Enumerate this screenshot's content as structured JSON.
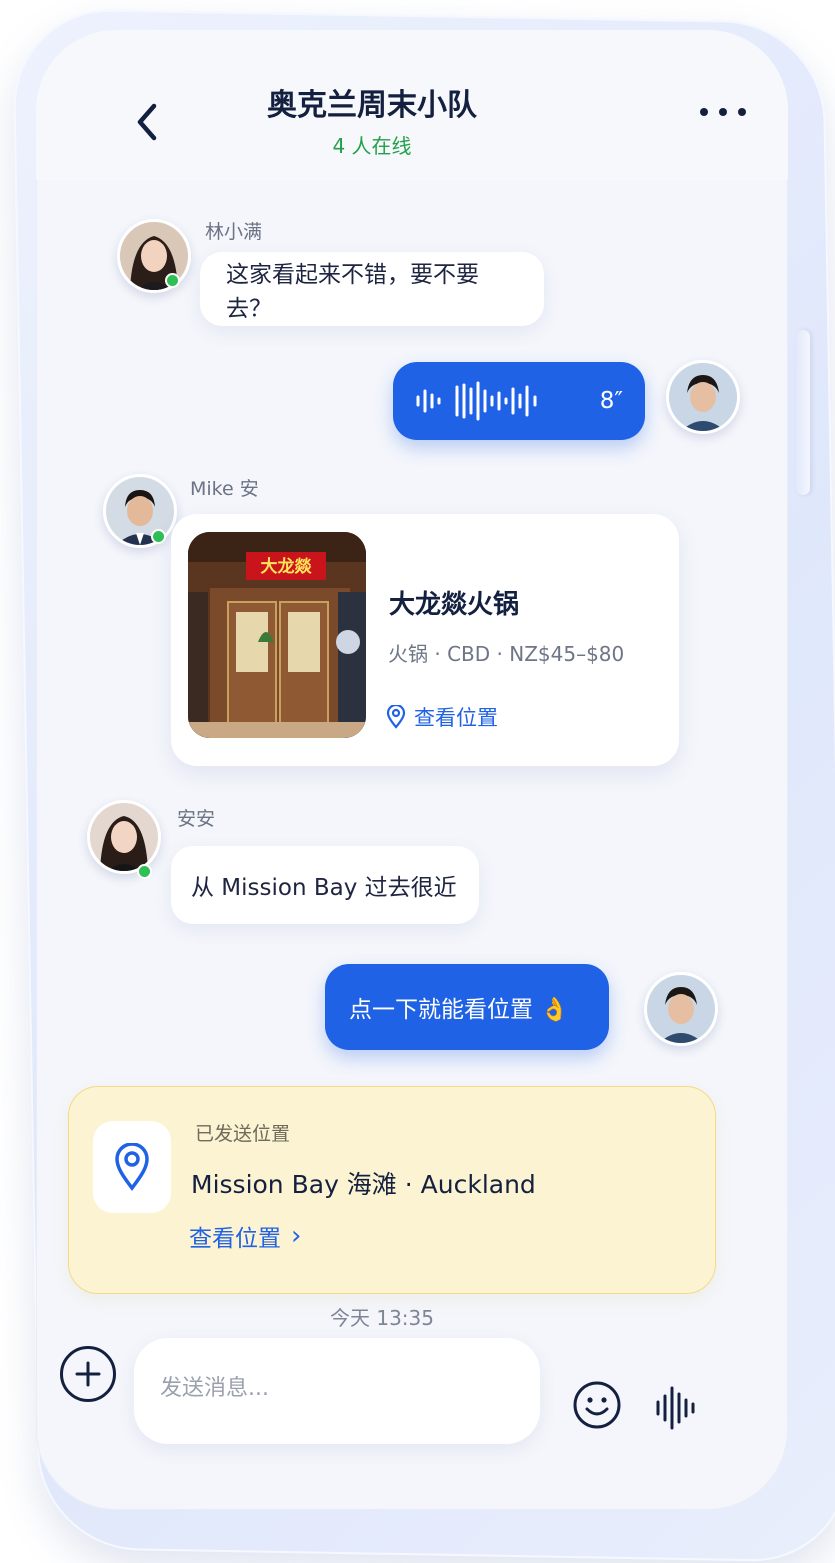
{
  "header": {
    "title": "奥克兰周末小队",
    "online_status": "4 人在线"
  },
  "messages": {
    "m1": {
      "sender": "林小满",
      "text": "这家看起来不错，要不要去？"
    },
    "m2": {
      "type": "voice",
      "duration": "8″"
    },
    "m3": {
      "sender": "Mike 安",
      "restaurant_name": "大龙燚火锅",
      "restaurant_meta": "火锅 · CBD · NZ$45–$80",
      "sign_text": "大龙燚",
      "link_label": "查看位置"
    },
    "m4": {
      "sender": "安安",
      "text": "从 Mission Bay 过去很近"
    },
    "m5": {
      "text": "点一下就能看位置 👌"
    }
  },
  "location_share": {
    "caption": "已发送位置",
    "place": "Mission Bay 海滩 · Auckland",
    "link_label": "查看位置",
    "link_chevron": "›"
  },
  "timestamp": "今天 13:35",
  "composer": {
    "placeholder": "发送消息..."
  },
  "colors": {
    "accent": "#1f62e6",
    "online": "#2fbf55",
    "title": "#14203f",
    "location_card_bg": "#fcf3d2"
  },
  "icons": [
    "back-icon",
    "more-icon",
    "waveform-icon",
    "pin-icon",
    "plus-icon",
    "emoji-icon",
    "voice-icon"
  ]
}
